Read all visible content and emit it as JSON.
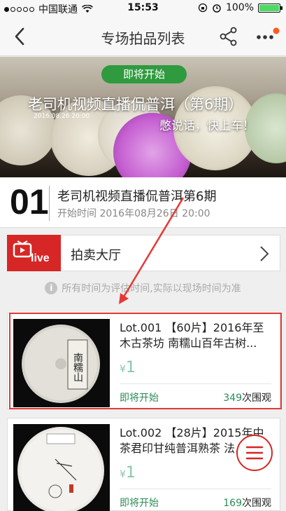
{
  "status_bar": {
    "carrier": "中国联通",
    "time": "15:53",
    "battery": "100%"
  },
  "nav": {
    "title": "专场拍品列表"
  },
  "banner": {
    "badge": "即将开始",
    "title": "老司机视频直播侃普洱（第6期）",
    "date": "2016.08.26 20:00",
    "slogan": "憋说话，快上车！"
  },
  "event": {
    "number": "01",
    "title": "老司机视频直播侃普洱第6期",
    "start_time": "开始时间 2016年08月26日 20:00"
  },
  "hall": {
    "live_label": "live",
    "label": "拍卖大厅"
  },
  "notice": "所有时间为评估时间,实际以现场时间为准",
  "lots": [
    {
      "title": "Lot.001 【60片】2016年至木古茶坊 南糯山百年古树...",
      "price_symbol": "¥",
      "price": "1",
      "status": "即将开始",
      "views": "349",
      "views_suffix": "次围观",
      "thumb_text": "南糯山"
    },
    {
      "title": "Lot.002 【28片】2015年中茶君印甘纯普洱熟茶 法...",
      "price_symbol": "¥",
      "price": "1",
      "status": "即将开始",
      "views": "169",
      "views_suffix": "次围观"
    }
  ],
  "colors": {
    "accent_red": "#d62625",
    "green": "#2e8b57",
    "badge_green": "#2f9a3e"
  }
}
